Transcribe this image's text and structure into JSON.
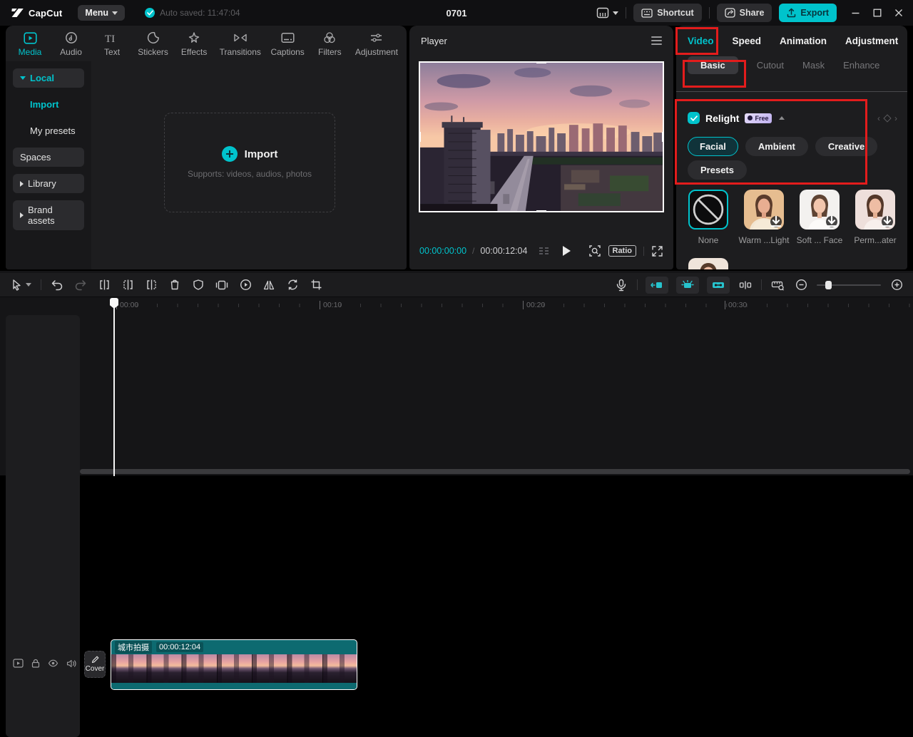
{
  "colors": {
    "accent": "#00c3cc",
    "annotation": "#e31c1c"
  },
  "topbar": {
    "logo": "CapCut",
    "menu": "Menu",
    "autosaved": "Auto saved: 11:47:04",
    "title": "0701",
    "shortcut": "Shortcut",
    "share": "Share",
    "export": "Export"
  },
  "media": {
    "tabs": [
      {
        "label": "Media",
        "active": true
      },
      {
        "label": "Audio"
      },
      {
        "label": "Text"
      },
      {
        "label": "Stickers"
      },
      {
        "label": "Effects"
      },
      {
        "label": "Transitions"
      },
      {
        "label": "Captions"
      },
      {
        "label": "Filters"
      },
      {
        "label": "Adjustment"
      }
    ],
    "sidebar": [
      {
        "label": "Local"
      },
      {
        "label": "Import"
      },
      {
        "label": "My presets"
      },
      {
        "label": "Spaces"
      },
      {
        "label": "Library"
      },
      {
        "label": "Brand assets"
      }
    ],
    "dropzone": {
      "title": "Import",
      "hint": "Supports: videos, audios, photos"
    }
  },
  "player": {
    "title": "Player",
    "current": "00:00:00:00",
    "separator": "/",
    "duration": "00:00:12:04",
    "ratio": "Ratio"
  },
  "inspector": {
    "tabs": [
      {
        "label": "Video",
        "active": true
      },
      {
        "label": "Speed"
      },
      {
        "label": "Animation"
      },
      {
        "label": "Adjustment"
      }
    ],
    "subtabs": [
      {
        "label": "Basic",
        "active": true
      },
      {
        "label": "Cutout"
      },
      {
        "label": "Mask"
      },
      {
        "label": "Enhance"
      }
    ],
    "relight": {
      "title": "Relight",
      "badge": "Free",
      "enabled": true,
      "modes": [
        {
          "label": "Facial",
          "active": true
        },
        {
          "label": "Ambient"
        },
        {
          "label": "Creative"
        },
        {
          "label": "Presets"
        }
      ],
      "presets": [
        {
          "label": "None",
          "selected": true
        },
        {
          "label": "Warm ...Light"
        },
        {
          "label": "Soft ... Face"
        },
        {
          "label": "Perm...ater"
        }
      ]
    }
  },
  "timeline": {
    "ruler": [
      "00:00",
      "00:10",
      "00:20",
      "00:30"
    ],
    "cover": "Cover",
    "clip": {
      "name": "城市拍摄",
      "duration": "00:00:12:04"
    }
  }
}
